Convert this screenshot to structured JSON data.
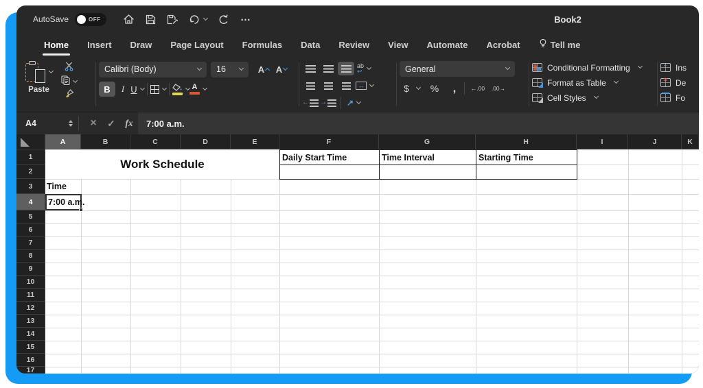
{
  "window": {
    "title": "Book2"
  },
  "quick_access": {
    "autosave_label": "AutoSave",
    "autosave_state": "OFF",
    "overflow_icon": "…"
  },
  "tabs": [
    {
      "label": "Home",
      "active": true
    },
    {
      "label": "Insert"
    },
    {
      "label": "Draw"
    },
    {
      "label": "Page Layout"
    },
    {
      "label": "Formulas"
    },
    {
      "label": "Data"
    },
    {
      "label": "Review"
    },
    {
      "label": "View"
    },
    {
      "label": "Automate"
    },
    {
      "label": "Acrobat"
    },
    {
      "label": "Tell me",
      "icon": "lightbulb"
    }
  ],
  "ribbon": {
    "clipboard": {
      "paste_label": "Paste"
    },
    "font": {
      "name": "Calibri (Body)",
      "size": "16",
      "bold": "B",
      "italic": "I",
      "underline": "U",
      "grow_font": "A",
      "shrink_font": "A",
      "font_color_glyph": "A",
      "wrap_glyph": "ab",
      "wrap_return": "↩"
    },
    "alignment": {
      "merge_glyph": "↔",
      "outdent_arrow": "←",
      "indent_arrow": "→",
      "orientation_glyph": "↗"
    },
    "number": {
      "format": "General",
      "currency": "$",
      "percent": "%",
      "comma": ",",
      "increase_decimal": "←.00",
      "decrease_decimal": ".00→"
    },
    "styles": {
      "conditional_formatting": "Conditional Formatting",
      "format_as_table": "Format as Table",
      "cell_styles": "Cell Styles"
    },
    "cells": {
      "insert": "Ins",
      "delete": "De",
      "format": "Fo"
    }
  },
  "formula_bar": {
    "name_box": "A4",
    "cancel": "×",
    "enter": "✓",
    "fx": "fx",
    "value": "7:00 a.m."
  },
  "sheet": {
    "columns": [
      "A",
      "B",
      "C",
      "D",
      "E",
      "F",
      "G",
      "H",
      "I",
      "J",
      "K"
    ],
    "rows": [
      "1",
      "2",
      "3",
      "4",
      "5",
      "6",
      "7",
      "8",
      "9",
      "10",
      "11",
      "12",
      "13",
      "14",
      "15",
      "16",
      "17"
    ],
    "selected_column": "A",
    "selected_row": "4",
    "cells": {
      "merged_title": "Work Schedule",
      "daily_start_time": "Daily Start Time",
      "time_interval": "Time Interval",
      "starting_time": "Starting Time",
      "time_label": "Time",
      "selected_value": "7:00 a.m."
    }
  },
  "colors": {
    "accent_frame": "#149bf6",
    "chrome": "#282828",
    "fill_yellow": "#e3d84b",
    "font_red": "#d25b35",
    "icon_blue": "#4a9fe8"
  }
}
